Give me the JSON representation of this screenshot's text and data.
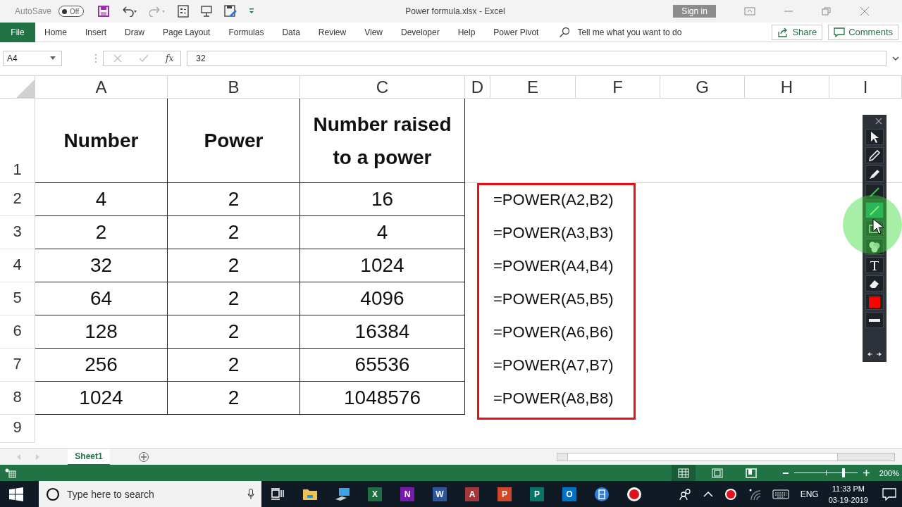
{
  "title_bar": {
    "autosave_label": "AutoSave",
    "autosave_toggle": {
      "label": "Off",
      "on": false
    },
    "title": "Power formula.xlsx - Excel",
    "sign_in": "Sign in"
  },
  "ribbon_tabs": [
    {
      "label": "File",
      "kind": "file"
    },
    {
      "label": "Home",
      "kind": "tab"
    },
    {
      "label": "Insert",
      "kind": "tab"
    },
    {
      "label": "Draw",
      "kind": "tab"
    },
    {
      "label": "Page Layout",
      "kind": "tab"
    },
    {
      "label": "Formulas",
      "kind": "tab"
    },
    {
      "label": "Data",
      "kind": "tab"
    },
    {
      "label": "Review",
      "kind": "tab"
    },
    {
      "label": "View",
      "kind": "tab"
    },
    {
      "label": "Developer",
      "kind": "tab"
    },
    {
      "label": "Help",
      "kind": "tab"
    },
    {
      "label": "Power Pivot",
      "kind": "tab"
    }
  ],
  "tell_me": {
    "placeholder": "Tell me what you want to do"
  },
  "share": "Share",
  "comments": "Comments",
  "formula_bar": {
    "name_box": "A4",
    "function_label": "fx",
    "value": "32"
  },
  "sheet": {
    "columns": [
      "A",
      "B",
      "C",
      "D",
      "E",
      "F",
      "G",
      "H",
      "I"
    ],
    "header_row": {
      "number": "1",
      "cells": [
        "Number",
        "Power",
        "Number raised to a power"
      ]
    },
    "rows": [
      {
        "number": "2",
        "cells": [
          "4",
          "2",
          "16"
        ],
        "formula": "=POWER(A2,B2)"
      },
      {
        "number": "3",
        "cells": [
          "2",
          "2",
          "4"
        ],
        "formula": "=POWER(A3,B3)"
      },
      {
        "number": "4",
        "cells": [
          "32",
          "2",
          "1024"
        ],
        "formula": "=POWER(A4,B4)"
      },
      {
        "number": "5",
        "cells": [
          "64",
          "2",
          "4096"
        ],
        "formula": "=POWER(A5,B5)"
      },
      {
        "number": "6",
        "cells": [
          "128",
          "2",
          "16384"
        ],
        "formula": "=POWER(A6,B6)"
      },
      {
        "number": "7",
        "cells": [
          "256",
          "2",
          "65536"
        ],
        "formula": "=POWER(A7,B7)"
      },
      {
        "number": "8",
        "cells": [
          "1024",
          "2",
          "1048576"
        ],
        "formula": "=POWER(A8,B8)"
      }
    ],
    "empty_rows": [
      "9"
    ]
  },
  "sheet_tabs": [
    {
      "label": "Sheet1",
      "selected": true
    }
  ],
  "status_bar": {
    "views": [
      {
        "kind": "normal",
        "selected": true
      },
      {
        "kind": "page_layout",
        "selected": false
      },
      {
        "kind": "page_break",
        "selected": false
      }
    ],
    "zoom_slider": {
      "level": 0.78
    },
    "zoom": "200%"
  },
  "annotation_tools": [
    {
      "kind": "pointer",
      "selected": false
    },
    {
      "kind": "pencil",
      "selected": false
    },
    {
      "kind": "marker",
      "selected": false
    },
    {
      "kind": "line",
      "selected": false
    },
    {
      "kind": "line",
      "selected": true
    },
    {
      "kind": "rectangle",
      "selected": false
    },
    {
      "kind": "stamp",
      "selected": false
    },
    {
      "kind": "text",
      "selected": false
    },
    {
      "kind": "eraser",
      "selected": false
    },
    {
      "kind": "color",
      "selected": false,
      "color": "#ff0000"
    },
    {
      "kind": "width",
      "selected": false
    }
  ],
  "taskbar": {
    "search": {
      "placeholder": "Type here to search"
    },
    "apps": [
      {
        "kind": "taskview"
      },
      {
        "kind": "folder"
      },
      {
        "kind": "computer"
      },
      {
        "kind": "tile",
        "letter": "X",
        "color": "#1d6f42"
      },
      {
        "kind": "tile",
        "letter": "N",
        "color": "#7719aa"
      },
      {
        "kind": "tile",
        "letter": "W",
        "color": "#2b579a"
      },
      {
        "kind": "tile",
        "letter": "A",
        "color": "#a4373a"
      },
      {
        "kind": "tile",
        "letter": "P",
        "color": "#d24726"
      },
      {
        "kind": "tile",
        "letter": "P",
        "color": "#077568"
      },
      {
        "kind": "tile",
        "letter": "O",
        "color": "#0072c6"
      },
      {
        "kind": "film"
      },
      {
        "kind": "record"
      }
    ],
    "language": "ENG",
    "time": "11:33 PM",
    "date": "03-19-2019"
  }
}
